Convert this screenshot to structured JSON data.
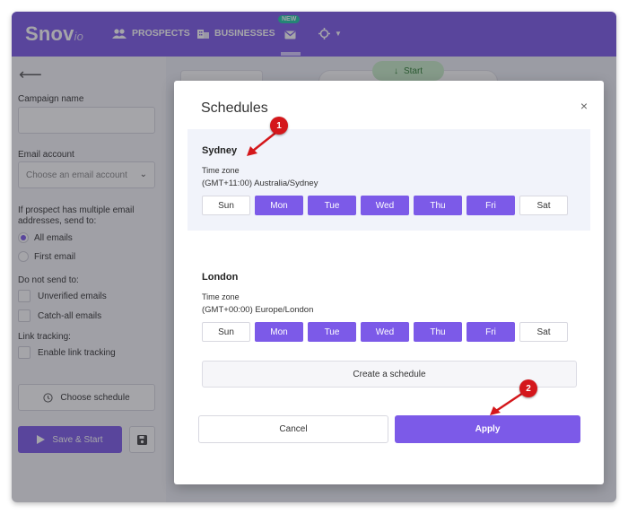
{
  "brand": {
    "name": "Snov",
    "suffix": "io"
  },
  "nav": {
    "prospects": "PROSPECTS",
    "businesses": "BUSINESSES",
    "new_badge": "NEW"
  },
  "bg": {
    "start_label": "Start"
  },
  "sidebar": {
    "campaign_name_label": "Campaign name",
    "email_account_label": "Email account",
    "email_account_placeholder": "Choose an email account",
    "multiple_label_line1": "If prospect has multiple email",
    "multiple_label_line2": "addresses, send to:",
    "radio_all": "All emails",
    "radio_first": "First email",
    "do_not_send_label": "Do not send to:",
    "check_unverified": "Unverified emails",
    "check_catchall": "Catch-all emails",
    "link_tracking_label": "Link tracking:",
    "check_link_tracking": "Enable link tracking",
    "choose_schedule": "Choose schedule",
    "save_start": "Save & Start"
  },
  "modal": {
    "title": "Schedules",
    "close": "×",
    "timezone_label": "Time zone",
    "schedules": [
      {
        "name": "Sydney",
        "timezone": "(GMT+11:00) Australia/Sydney",
        "days": [
          {
            "label": "Sun",
            "on": false
          },
          {
            "label": "Mon",
            "on": true
          },
          {
            "label": "Tue",
            "on": true
          },
          {
            "label": "Wed",
            "on": true
          },
          {
            "label": "Thu",
            "on": true
          },
          {
            "label": "Fri",
            "on": true
          },
          {
            "label": "Sat",
            "on": false
          }
        ]
      },
      {
        "name": "London",
        "timezone": "(GMT+00:00) Europe/London",
        "days": [
          {
            "label": "Sun",
            "on": false
          },
          {
            "label": "Mon",
            "on": true
          },
          {
            "label": "Tue",
            "on": true
          },
          {
            "label": "Wed",
            "on": true
          },
          {
            "label": "Thu",
            "on": true
          },
          {
            "label": "Fri",
            "on": true
          },
          {
            "label": "Sat",
            "on": false
          }
        ]
      }
    ],
    "create_label": "Create a schedule",
    "cancel_label": "Cancel",
    "apply_label": "Apply"
  },
  "annotations": [
    "1",
    "2"
  ],
  "colors": {
    "accent": "#7c5ae8",
    "badge": "#21c8a8",
    "marker": "#d4171b"
  }
}
